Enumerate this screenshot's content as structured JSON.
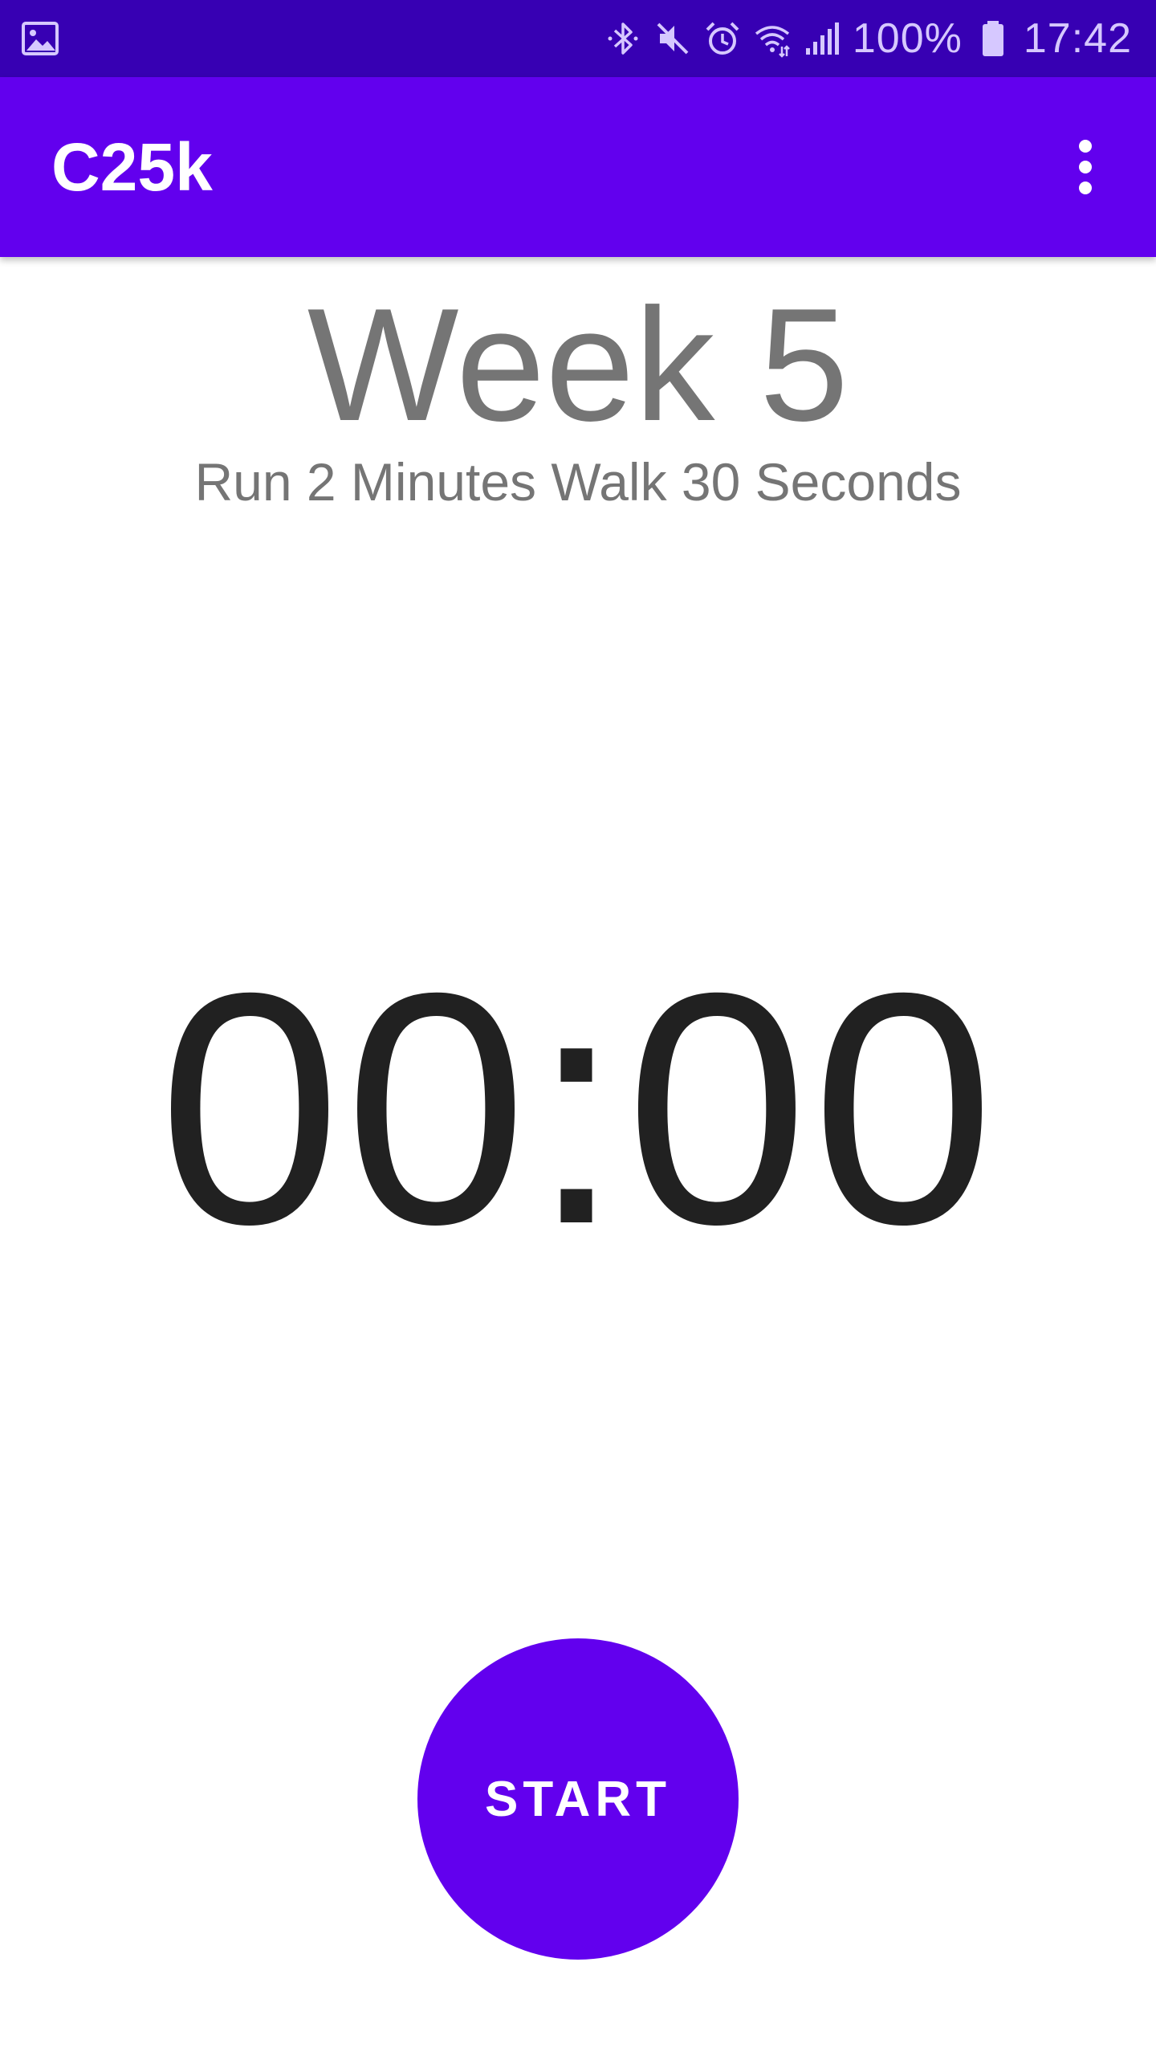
{
  "status_bar": {
    "battery_text": "100%",
    "time": "17:42",
    "icons": [
      "image-icon",
      "bluetooth-icon",
      "mute-icon",
      "alarm-icon",
      "wifi-icon",
      "signal-icon",
      "battery-icon"
    ]
  },
  "app_bar": {
    "title": "C25k",
    "overflow_icon": "more-vert-icon"
  },
  "content": {
    "week_title": "Week 5",
    "subtitle": "Run 2 Minutes Walk 30 Seconds",
    "timer": "00:00",
    "start_label": "START"
  },
  "colors": {
    "status_bar": "#3700b3",
    "app_bar": "#6200ee",
    "accent": "#6200ee",
    "title_text": "#757575",
    "timer_text": "#212121"
  }
}
